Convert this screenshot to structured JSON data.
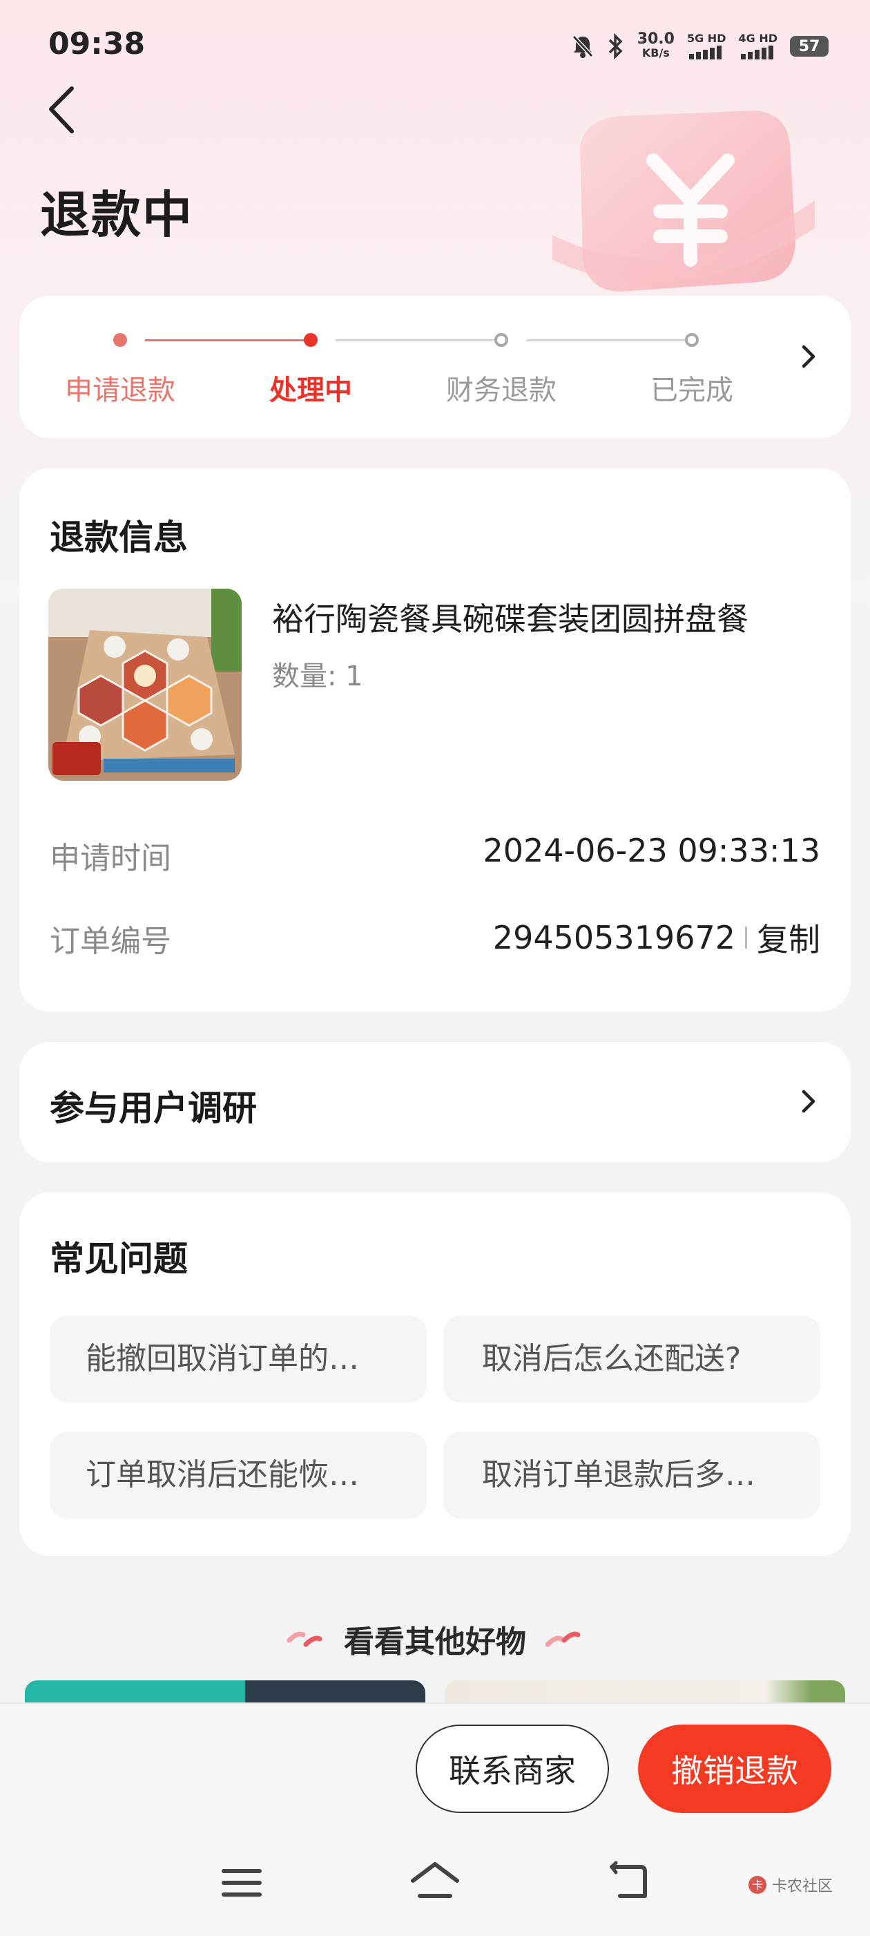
{
  "status_bar": {
    "time": "09:38",
    "speed_value": "30.0",
    "speed_unit": "KB/s",
    "sim1": "5G HD",
    "sim2": "4G HD",
    "battery": "57"
  },
  "header": {
    "title": "退款中"
  },
  "progress": {
    "steps": [
      {
        "label": "申请退款",
        "state": "done"
      },
      {
        "label": "处理中",
        "state": "current"
      },
      {
        "label": "财务退款",
        "state": "pending"
      },
      {
        "label": "已完成",
        "state": "pending"
      }
    ]
  },
  "refund_info": {
    "title": "退款信息",
    "product_name": "裕行陶瓷餐具碗碟套装团圆拼盘餐",
    "quantity": "数量: 1",
    "apply_time_label": "申请时间",
    "apply_time": "2024-06-23 09:33:13",
    "order_no_label": "订单编号",
    "order_no": "294505319672",
    "copy_label": "复制"
  },
  "survey": {
    "label": "参与用户调研"
  },
  "faq": {
    "title": "常见问题",
    "items": [
      "能撤回取消订单的…",
      "取消后怎么还配送?",
      "订单取消后还能恢…",
      "取消订单退款后多…"
    ]
  },
  "recommend": {
    "title": "看看其他好物"
  },
  "actions": {
    "contact": "联系商家",
    "cancel_refund": "撤销退款"
  },
  "watermark": {
    "text": "卡农社区"
  },
  "colors": {
    "accent": "#f43a22",
    "step_done": "#e8756c",
    "step_current": "#e8322a",
    "step_pending": "#9a9a9a"
  }
}
